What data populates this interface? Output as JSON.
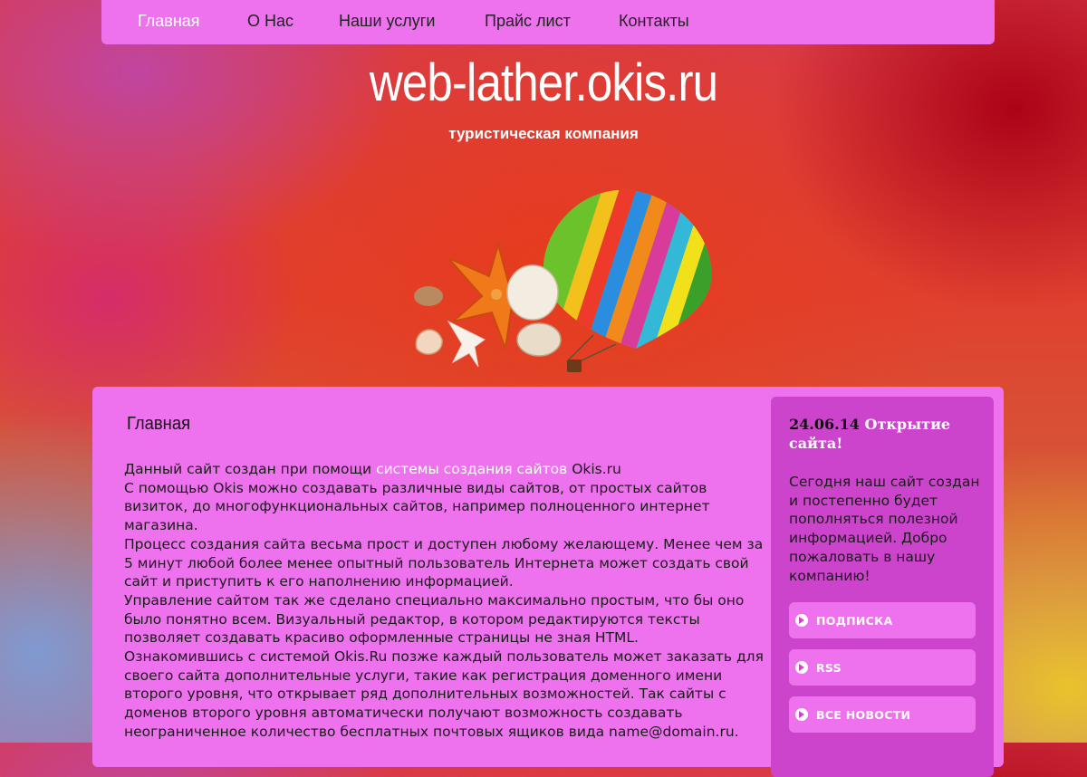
{
  "nav": {
    "items": [
      {
        "label": "Главная"
      },
      {
        "label": "О Нас"
      },
      {
        "label": "Наши услуги"
      },
      {
        "label": "Прайс лист"
      },
      {
        "label": "Контакты"
      }
    ]
  },
  "header": {
    "title": "web-lather.okis.ru",
    "subtitle": "туристическая компания",
    "hero_image": "hot-air-balloon-and-seashells"
  },
  "content": {
    "title": "Главная",
    "intro_prefix": "Данный сайт создан при помощи ",
    "intro_link": "системы создания сайтов",
    "intro_suffix": " Okis.ru",
    "p1": "С помощью Okis можно создавать различные виды сайтов, от простых сайтов визиток, до многофункциональных сайтов, например полноценного интернет магазина.",
    "p2": "Процесс создания сайта весьма прост и доступен любому желающему. Менее чем за 5 минут любой более менее опытный пользователь Интернета может создать свой сайт и приступить к его наполнению информацией.",
    "p3": "Управление сайтом так же сделано специально максимально простым, что бы оно было понятно всем. Визуальный редактор, в котором редактируются тексты позволяет создавать красиво оформленные страницы не зная HTML.",
    "p4": "Ознакомившись с системой Okis.Ru позже каждый пользователь может заказать для своего сайта дополнительные услуги, такие как регистрация доменного имени второго уровня, что открывает ряд дополнительных возможностей. Так сайты с доменов второго уровня автоматически получают возможность создавать неограниченное количество бесплатных почтовых ящиков вида name@domain.ru."
  },
  "sidebar": {
    "news_date": "24.06.14",
    "news_title": "Открытие сайта!",
    "news_text": "Сегодня наш сайт создан и постепенно будет пополняться полезной информацией. Добро пожаловать в нашу компанию!",
    "buttons": [
      {
        "label": "ПОДПИСКА",
        "icon": "arrow-circle-icon"
      },
      {
        "label": "RSS",
        "icon": "arrow-circle-icon"
      },
      {
        "label": "ВСЕ НОВОСТИ",
        "icon": "arrow-circle-icon"
      }
    ]
  },
  "colors": {
    "nav_bg": "#ee72ee",
    "sidebar_bg": "#cc44cc",
    "link": "#ffffff"
  }
}
